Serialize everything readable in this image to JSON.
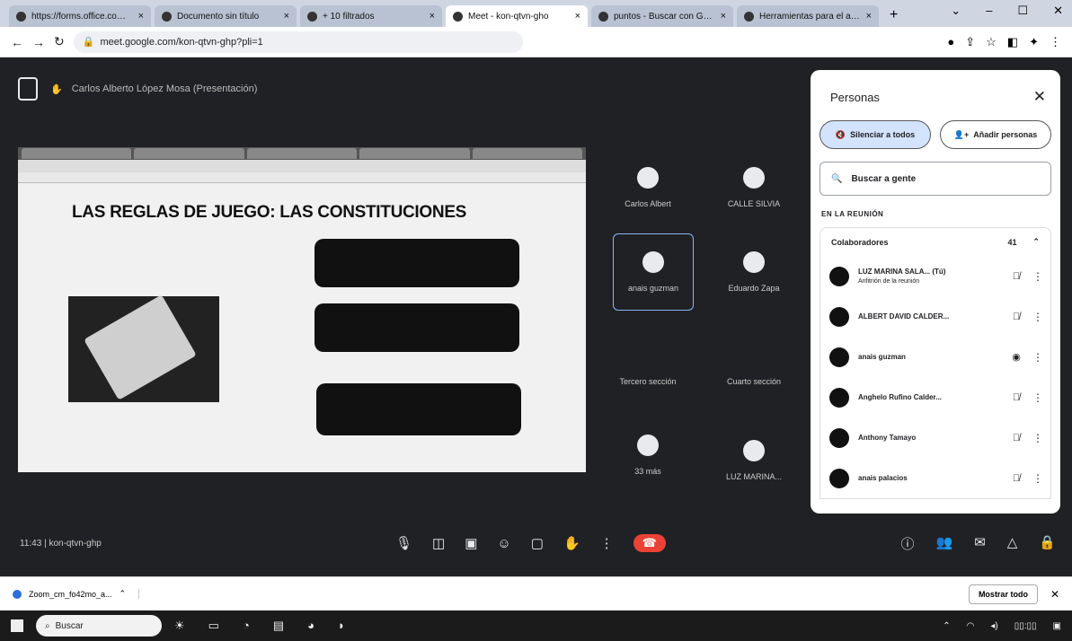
{
  "browser": {
    "tabs": [
      {
        "label": "https://forms.office.com/..."
      },
      {
        "label": "Documento sin título"
      },
      {
        "label": "+ 10 filtrados"
      },
      {
        "label": "Meet - kon-qtvn-gho",
        "active": true
      },
      {
        "label": "puntos - Buscar con Google"
      },
      {
        "label": "Herramientas para el aula"
      }
    ],
    "url": "meet.google.com/kon-qtvn-ghp?pli=1"
  },
  "meet": {
    "presenter_label": "Carlos Alberto López Mosa (Presentación)",
    "slide_title": "LAS REGLAS DE JUEGO: LAS CONSTITUCIONES",
    "tiles": [
      {
        "name": "Carlos Albert"
      },
      {
        "name": "CALLE SILVIA"
      },
      {
        "name": "anais guzman"
      },
      {
        "name": "Eduardo Zapa"
      },
      {
        "name": "Tercero sección"
      },
      {
        "name": "Cuarto sección"
      },
      {
        "name": "33 más"
      },
      {
        "name": "LUZ MARINA..."
      }
    ],
    "meeting_time": "11:43",
    "meeting_code": "kon-qtvn-ghp"
  },
  "panel": {
    "title": "Personas",
    "mute_all": "Silenciar a todos",
    "add_people": "Añadir personas",
    "search_placeholder": "Buscar a gente",
    "section": "EN LA REUNIÓN",
    "group_label": "Colaboradores",
    "group_count": "41",
    "people": [
      {
        "name": "LUZ MARINA SALA... (Tú)",
        "sub": "Anfitrión de la reunión",
        "mic": "muted"
      },
      {
        "name": "ALBERT DAVID CALDER...",
        "sub": "",
        "mic": "muted"
      },
      {
        "name": "anais guzman",
        "sub": "",
        "mic": "active"
      },
      {
        "name": "Anghelo Rufino Calder...",
        "sub": "",
        "mic": "muted"
      },
      {
        "name": "Anthony Tamayo",
        "sub": "",
        "mic": "muted"
      },
      {
        "name": "anais palacios",
        "sub": "",
        "mic": "muted"
      }
    ]
  },
  "downloads": {
    "file": "Zoom_cm_fo42mo_a...",
    "show_all": "Mostrar todo"
  },
  "taskbar": {
    "search": "Buscar"
  },
  "colors": {
    "meet_bg": "#202124",
    "accent": "#8ab4f8",
    "hangup": "#ea4335"
  }
}
